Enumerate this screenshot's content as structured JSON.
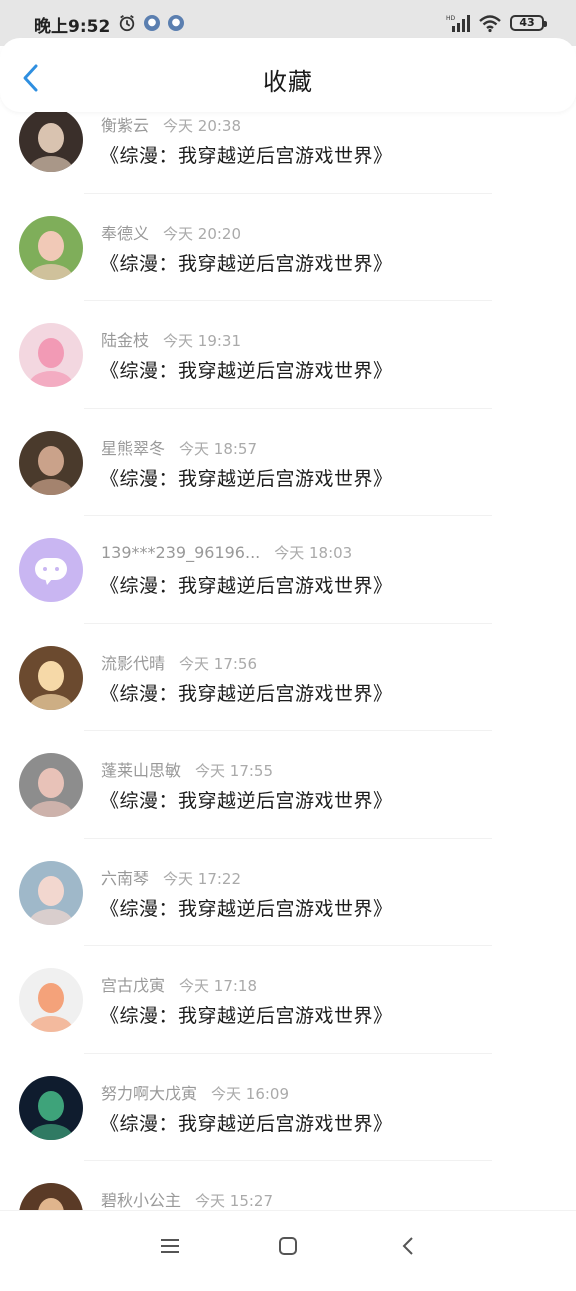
{
  "status": {
    "time": "晚上9:52",
    "battery": "43"
  },
  "header": {
    "title": "收藏"
  },
  "items": [
    {
      "name": "衡紫云",
      "time": "今天 20:38",
      "title": "《综漫：我穿越逆后宫游戏世界》"
    },
    {
      "name": "奉德义",
      "time": "今天 20:20",
      "title": "《综漫：我穿越逆后宫游戏世界》"
    },
    {
      "name": "陆金枝",
      "time": "今天 19:31",
      "title": "《综漫：我穿越逆后宫游戏世界》"
    },
    {
      "name": "星熊翠冬",
      "time": "今天 18:57",
      "title": "《综漫：我穿越逆后宫游戏世界》"
    },
    {
      "name": "139***239_96196...",
      "time": "今天 18:03",
      "title": "《综漫：我穿越逆后宫游戏世界》"
    },
    {
      "name": "流影代晴",
      "time": "今天 17:56",
      "title": "《综漫：我穿越逆后宫游戏世界》"
    },
    {
      "name": "蓬莱山思敏",
      "time": "今天 17:55",
      "title": "《综漫：我穿越逆后宫游戏世界》"
    },
    {
      "name": "六南琴",
      "time": "今天 17:22",
      "title": "《综漫：我穿越逆后宫游戏世界》"
    },
    {
      "name": "宫古戊寅",
      "time": "今天 17:18",
      "title": "《综漫：我穿越逆后宫游戏世界》"
    },
    {
      "name": "努力啊大戊寅",
      "time": "今天 16:09",
      "title": "《综漫：我穿越逆后宫游戏世界》"
    },
    {
      "name": "碧秋小公主",
      "time": "今天 15:27",
      "title": ""
    }
  ],
  "colors": {
    "accent": "#2f8fe0",
    "default_avatar": "#c9b6f2"
  }
}
